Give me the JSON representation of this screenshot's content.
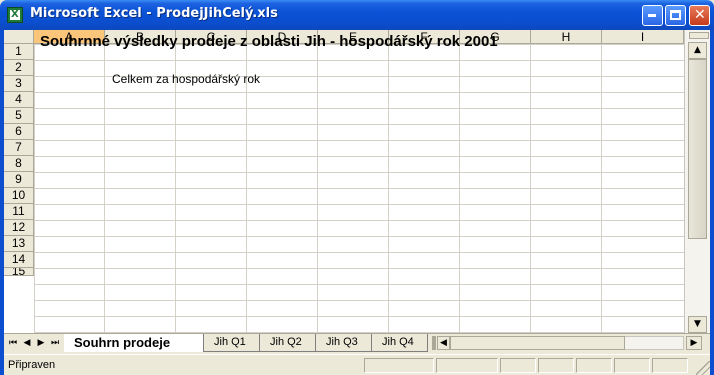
{
  "window": {
    "title": "Microsoft Excel - ProdejJihCelý.xls",
    "app_icon": "excel-icon",
    "buttons": {
      "minimize": "minimize-icon",
      "maximize": "maximize-icon",
      "close": "close-icon"
    },
    "close_glyph": "✕"
  },
  "columns": [
    "A",
    "B",
    "C",
    "D",
    "E",
    "F",
    "G",
    "H",
    "I"
  ],
  "selected_column": "A",
  "rows": [
    "1",
    "2",
    "3",
    "4",
    "5",
    "6",
    "7",
    "8",
    "9",
    "10",
    "11",
    "12",
    "13",
    "14",
    "15"
  ],
  "cells": {
    "A1": "Souhrnné výsledky prodeje z oblasti Jih - hospodářský rok 2001",
    "B3": "Celkem za hospodářský rok"
  },
  "sheet_tabs": [
    "Souhrn prodeje",
    "Jih Q1",
    "Jih Q2",
    "Jih Q3",
    "Jih Q4"
  ],
  "active_sheet": "Souhrn prodeje",
  "tab_nav": {
    "first": "⏮",
    "prev": "◀",
    "next": "▶",
    "last": "⏭"
  },
  "scroll_glyphs": {
    "up": "▲",
    "down": "▼",
    "left": "◀",
    "right": "▶"
  },
  "status": {
    "text": "Připraven"
  },
  "colors": {
    "titlebar": "#0b4fd0",
    "selected_header": "#fbc57a",
    "gridline": "#d4d0c8"
  }
}
